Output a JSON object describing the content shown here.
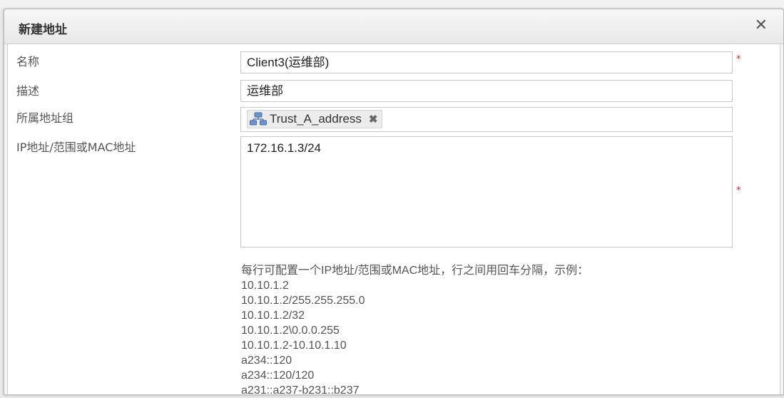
{
  "dialog": {
    "title": "新建地址",
    "close_symbol": "✕"
  },
  "form": {
    "name": {
      "label": "名称",
      "value": "Client3(运维部)",
      "required_mark": "*"
    },
    "description": {
      "label": "描述",
      "value": "运维部"
    },
    "group": {
      "label": "所属地址组",
      "tag_icon": "network-group-icon",
      "tag_label": "Trust_A_address",
      "tag_remove": "✖"
    },
    "address": {
      "label": "IP地址/范围或MAC地址",
      "value": "172.16.1.3/24",
      "required_mark": "*"
    }
  },
  "hint": {
    "intro": "每行可配置一个IP地址/范围或MAC地址，行之间用回车分隔，示例：",
    "examples": [
      "10.10.1.2",
      "10.10.1.2/255.255.255.0",
      "10.10.1.2/32",
      "10.10.1.2\\0.0.0.255",
      "10.10.1.2-10.10.1.10",
      "a234::120",
      "a234::120/120",
      "a231::a237-b231::b237"
    ]
  },
  "colors": {
    "required": "#e02020",
    "dialog_bg": "#f4f4f4",
    "content_bg": "#ffffff"
  }
}
